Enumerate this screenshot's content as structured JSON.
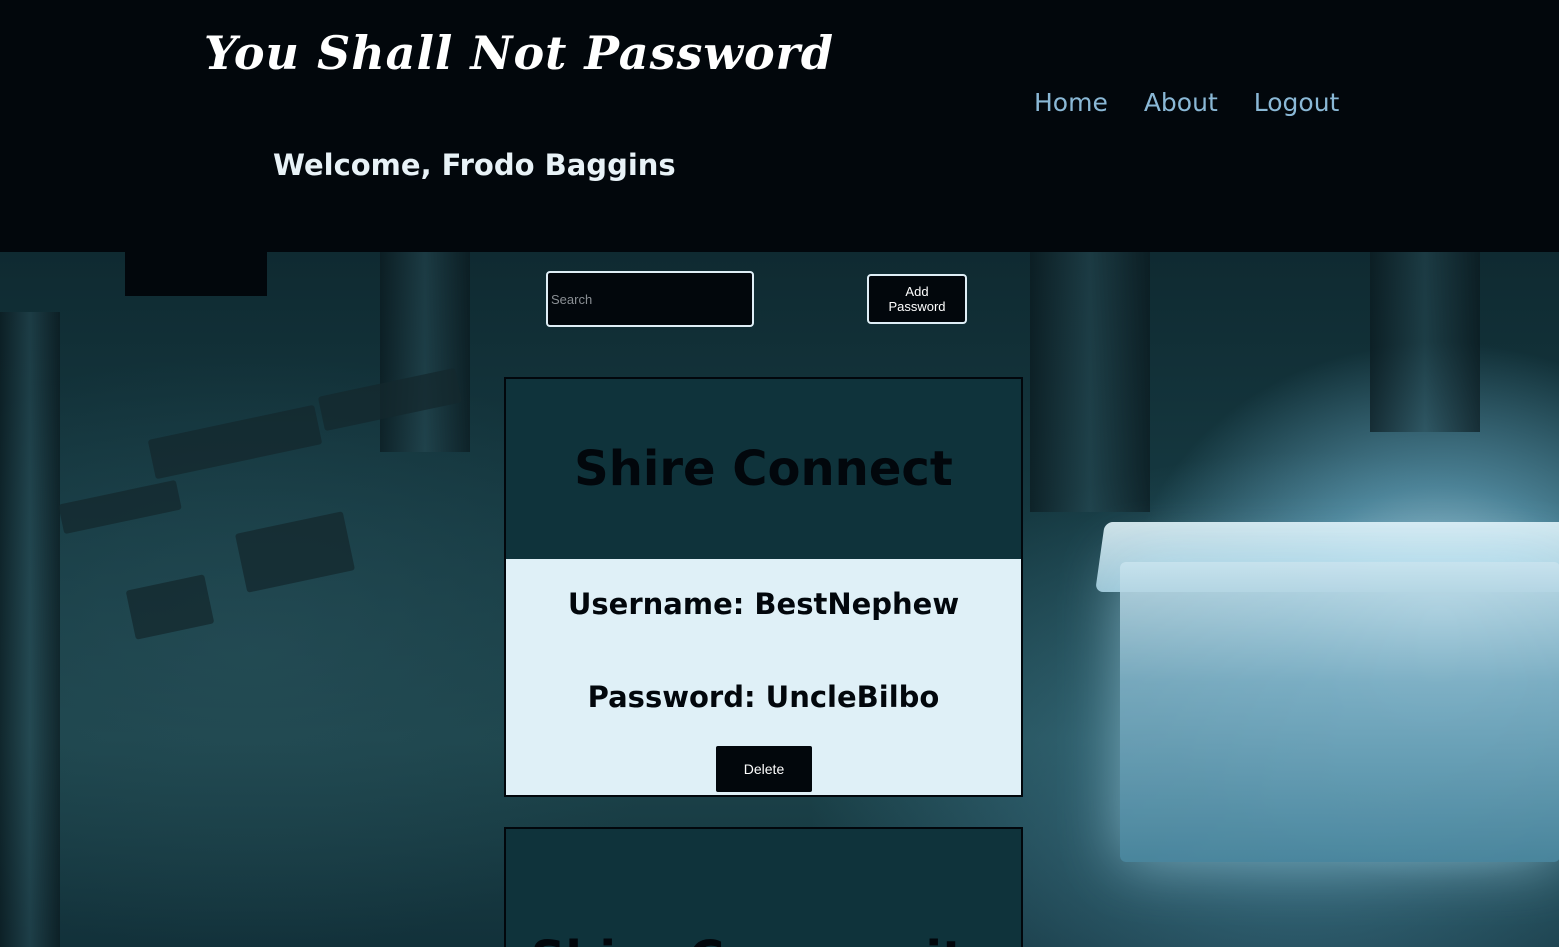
{
  "header": {
    "site_title": "You Shall Not Password",
    "welcome": "Welcome, Frodo Baggins"
  },
  "nav": {
    "items": [
      {
        "label": "Home"
      },
      {
        "label": "About"
      },
      {
        "label": "Logout"
      }
    ]
  },
  "controls": {
    "search_placeholder": "Search",
    "search_value": "",
    "add_button_label": "Add Password"
  },
  "cards": [
    {
      "title": "Shire Connect",
      "username_text": "Username: BestNephew",
      "password_text": "Password: UncleBilbo",
      "delete_label": "Delete"
    },
    {
      "title": "Shire Community"
    }
  ],
  "colors": {
    "header_bg": "#02070c",
    "nav_link": "#8ab8d6",
    "card_header": "#0f333b",
    "card_body": "#dff0f7"
  }
}
